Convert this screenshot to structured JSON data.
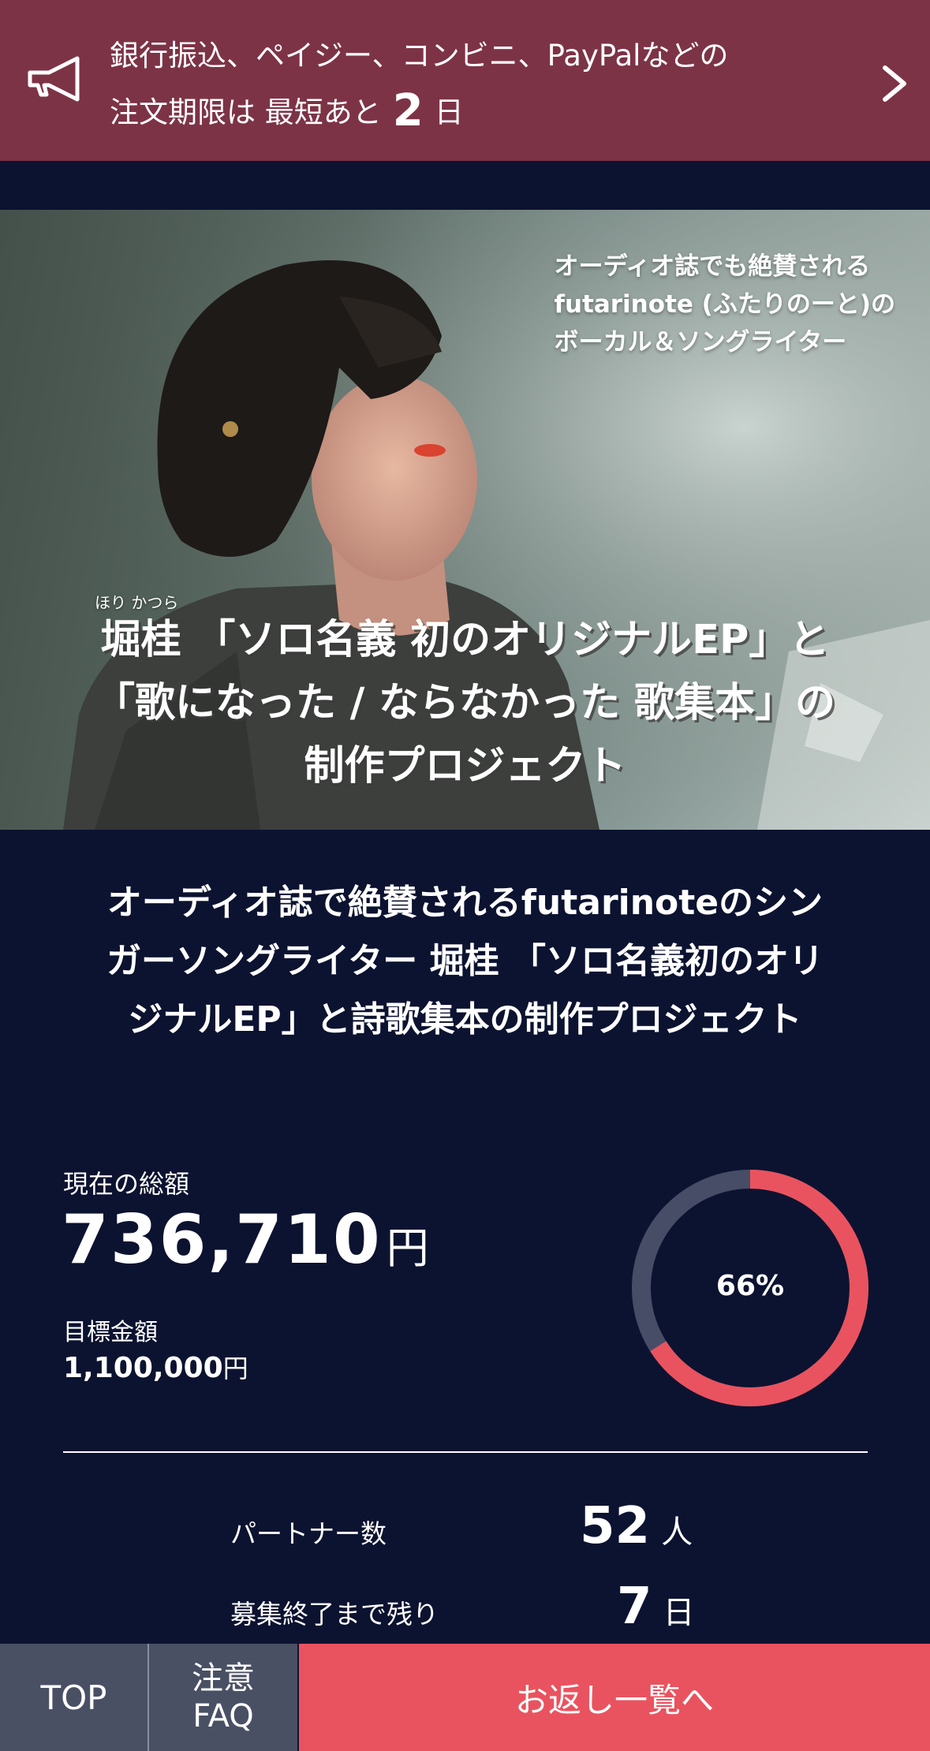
{
  "notice": {
    "line1": "銀行振込、ペイジー、コンビニ、PayPalなどの",
    "line2_prefix": "注文期限は 最短あと",
    "days_value": "2",
    "days_unit": "日",
    "icon": "megaphone-icon",
    "arrow_icon": "chevron-right-icon",
    "background": "#7d3346"
  },
  "hero": {
    "caption_lines": [
      "オーディオ誌でも絶賛される",
      "futarinote (ふたりのーと)の",
      "ボーカル＆ソングライター"
    ],
    "ruby": "ほり かつら",
    "title_lines": [
      "堀桂 「ソロ名義 初のオリジナルEP」と",
      "「歌になった / ならなかった 歌集本」の",
      "制作プロジェクト"
    ]
  },
  "project": {
    "title_lines": [
      "オーディオ誌で絶賛されるfutarinoteのシン",
      "ガーソングライター 堀桂 「ソロ名義初のオリ",
      "ジナルEP」と詩歌集本の制作プロジェクト"
    ]
  },
  "funding": {
    "total_label": "現在の総額",
    "total_value": "736,710",
    "total_unit": "円",
    "goal_label": "目標金額",
    "goal_value": "1,100,000",
    "goal_unit": "円",
    "progress_text": "66%",
    "progress_fraction": 0.66,
    "progress_color": "#e9535f",
    "track_color": "#474d66"
  },
  "stats": {
    "partners_label": "パートナー数",
    "partners_value": "52",
    "partners_unit": "人",
    "days_left_label": "募集終了まで残り",
    "days_left_value": "7",
    "days_left_unit": "日"
  },
  "nav": {
    "top_label": "TOP",
    "faq_line1": "注意",
    "faq_line2": "FAQ",
    "rewards_label": "お返し一覧へ",
    "rewards_color": "#e9535f"
  }
}
